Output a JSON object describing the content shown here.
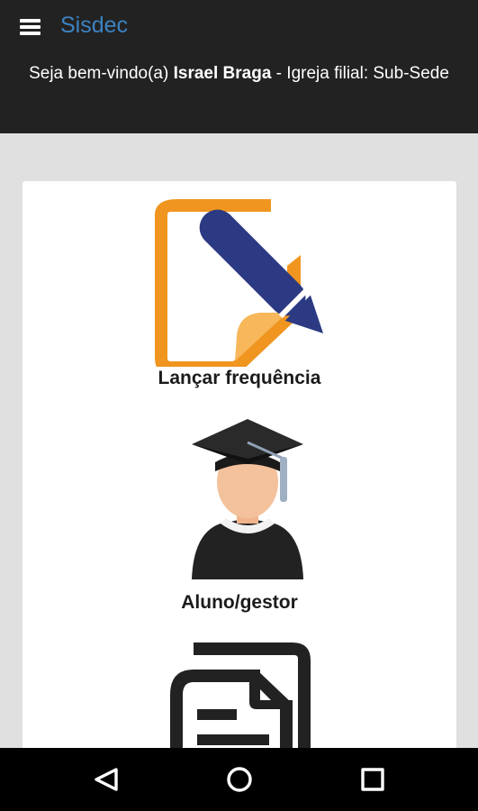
{
  "header": {
    "menu_icon": "hamburger-menu-icon",
    "title": "Sisdec",
    "title_color": "#3c82c2",
    "welcome": {
      "prefix": "Seja bem-vindo(a) ",
      "user_name": "Israel Braga",
      "suffix": " - Igreja filial: Sub-Sede"
    }
  },
  "menu": {
    "items": [
      {
        "label": "Lançar frequência",
        "icon": "edit-document-icon"
      },
      {
        "label": "Aluno/gestor",
        "icon": "student-graduate-icon"
      },
      {
        "label": "",
        "icon": "documents-copy-icon"
      }
    ]
  },
  "navigation": {
    "back_icon": "back-triangle-icon",
    "home_icon": "home-circle-icon",
    "recents_icon": "recents-square-icon"
  },
  "colors": {
    "header_bg": "#222222",
    "page_bg": "#e0e0e0",
    "accent_orange": "#f0951f",
    "pen_blue": "#2b3a82"
  }
}
